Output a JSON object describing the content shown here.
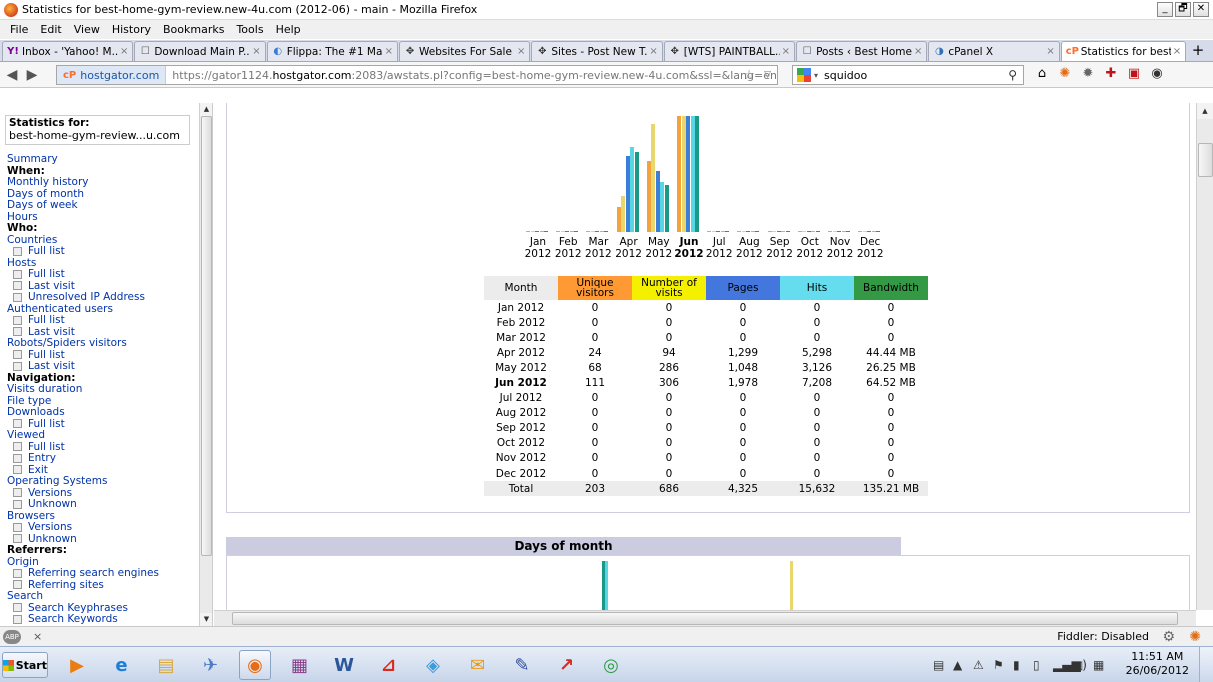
{
  "window": {
    "title": "Statistics for best-home-gym-review.new-4u.com (2012-06) - main - Mozilla Firefox",
    "min": "_",
    "max": "🗗",
    "close": "✕"
  },
  "menubar": [
    "File",
    "Edit",
    "View",
    "History",
    "Bookmarks",
    "Tools",
    "Help"
  ],
  "tabs": [
    {
      "label": "Inbox - 'Yahoo! M...",
      "icon": "Y!",
      "color": "#7b0099"
    },
    {
      "label": "Download Main P...",
      "icon": "☐",
      "color": "#555555"
    },
    {
      "label": "Flippa: The #1 Ma...",
      "icon": "◐",
      "color": "#3a7bd5"
    },
    {
      "label": "Websites For Sale ...",
      "icon": "✥",
      "color": "#333333"
    },
    {
      "label": "Sites - Post New T...",
      "icon": "✥",
      "color": "#333333"
    },
    {
      "label": "[WTS] PAINTBALL...",
      "icon": "✥",
      "color": "#333333"
    },
    {
      "label": "Posts ‹ Best Home...",
      "icon": "☐",
      "color": "#555555"
    },
    {
      "label": "cPanel X",
      "icon": "◑",
      "color": "#2f6fb7"
    },
    {
      "label": "Statistics for best-...",
      "icon": "cP",
      "color": "#ff6c2c"
    }
  ],
  "tab_close": "×",
  "tab_new": "+",
  "nav": {
    "back": "◀",
    "forward": "▶",
    "site_id": "hostgator.com",
    "site_prefix": "cP",
    "url_pre": "https://gator1124.",
    "url_domain": "hostgator.com",
    "url_post": ":2083/awstats.pl?config=best-home-gym-review.new-4u.com&ssl=&lang=en",
    "star": "☆",
    "url_drop": "▽",
    "search_value": "squidoo",
    "search_caret": "▾",
    "search_icon": "⚲",
    "toolbar_icons": [
      "⌂",
      "✺",
      "✹",
      "✚",
      "▣",
      "◉"
    ]
  },
  "sidebar": {
    "stats_label": "Statistics for:",
    "stats_value": "best-home-gym-review...u.com",
    "items": [
      {
        "t": "Summary",
        "k": "link"
      },
      {
        "t": "When:",
        "k": "head"
      },
      {
        "t": "Monthly history",
        "k": "link"
      },
      {
        "t": "Days of month",
        "k": "link"
      },
      {
        "t": "Days of week",
        "k": "link"
      },
      {
        "t": "Hours",
        "k": "link"
      },
      {
        "t": "Who:",
        "k": "head"
      },
      {
        "t": "Countries",
        "k": "link"
      },
      {
        "t": "Full list",
        "k": "sub"
      },
      {
        "t": "Hosts",
        "k": "link"
      },
      {
        "t": "Full list",
        "k": "sub"
      },
      {
        "t": "Last visit",
        "k": "sub"
      },
      {
        "t": "Unresolved IP Address",
        "k": "sub"
      },
      {
        "t": "Authenticated users",
        "k": "link"
      },
      {
        "t": "Full list",
        "k": "sub"
      },
      {
        "t": "Last visit",
        "k": "sub"
      },
      {
        "t": "Robots/Spiders visitors",
        "k": "link"
      },
      {
        "t": "Full list",
        "k": "sub"
      },
      {
        "t": "Last visit",
        "k": "sub"
      },
      {
        "t": "Navigation:",
        "k": "head"
      },
      {
        "t": "Visits duration",
        "k": "link"
      },
      {
        "t": "File type",
        "k": "link"
      },
      {
        "t": "Downloads",
        "k": "link"
      },
      {
        "t": "Full list",
        "k": "sub"
      },
      {
        "t": "Viewed",
        "k": "link"
      },
      {
        "t": "Full list",
        "k": "sub"
      },
      {
        "t": "Entry",
        "k": "sub"
      },
      {
        "t": "Exit",
        "k": "sub"
      },
      {
        "t": "Operating Systems",
        "k": "link"
      },
      {
        "t": "Versions",
        "k": "sub"
      },
      {
        "t": "Unknown",
        "k": "sub"
      },
      {
        "t": "Browsers",
        "k": "link"
      },
      {
        "t": "Versions",
        "k": "sub"
      },
      {
        "t": "Unknown",
        "k": "sub"
      },
      {
        "t": "Referrers:",
        "k": "head"
      },
      {
        "t": "Origin",
        "k": "link"
      },
      {
        "t": "Referring search engines",
        "k": "sub"
      },
      {
        "t": "Referring sites",
        "k": "sub"
      },
      {
        "t": "Search",
        "k": "link"
      },
      {
        "t": "Search Keyphrases",
        "k": "sub"
      },
      {
        "t": "Search Keywords",
        "k": "sub"
      }
    ],
    "scroll_up": "▲",
    "scroll_down": "▼"
  },
  "monthly": {
    "headers": [
      "Month",
      "Unique visitors",
      "Number of visits",
      "Pages",
      "Hits",
      "Bandwidth"
    ],
    "header_colors": [
      "#ececec",
      "#ff9933",
      "#f4f000",
      "#4477dd",
      "#66ddee",
      "#339944"
    ],
    "current_month": "Jun 2012",
    "rows": [
      [
        "Jan 2012",
        "0",
        "0",
        "0",
        "0",
        "0"
      ],
      [
        "Feb 2012",
        "0",
        "0",
        "0",
        "0",
        "0"
      ],
      [
        "Mar 2012",
        "0",
        "0",
        "0",
        "0",
        "0"
      ],
      [
        "Apr 2012",
        "24",
        "94",
        "1,299",
        "5,298",
        "44.44 MB"
      ],
      [
        "May 2012",
        "68",
        "286",
        "1,048",
        "3,126",
        "26.25 MB"
      ],
      [
        "Jun 2012",
        "111",
        "306",
        "1,978",
        "7,208",
        "64.52 MB"
      ],
      [
        "Jul 2012",
        "0",
        "0",
        "0",
        "0",
        "0"
      ],
      [
        "Aug 2012",
        "0",
        "0",
        "0",
        "0",
        "0"
      ],
      [
        "Sep 2012",
        "0",
        "0",
        "0",
        "0",
        "0"
      ],
      [
        "Oct 2012",
        "0",
        "0",
        "0",
        "0",
        "0"
      ],
      [
        "Nov 2012",
        "0",
        "0",
        "0",
        "0",
        "0"
      ],
      [
        "Dec 2012",
        "0",
        "0",
        "0",
        "0",
        "0"
      ]
    ],
    "total": [
      "Total",
      "203",
      "686",
      "4,325",
      "15,632",
      "135.21 MB"
    ],
    "chart_months": [
      {
        "m": "Jan",
        "y": "2012"
      },
      {
        "m": "Feb",
        "y": "2012"
      },
      {
        "m": "Mar",
        "y": "2012"
      },
      {
        "m": "Apr",
        "y": "2012"
      },
      {
        "m": "May",
        "y": "2012"
      },
      {
        "m": "Jun",
        "y": "2012"
      },
      {
        "m": "Jul",
        "y": "2012"
      },
      {
        "m": "Aug",
        "y": "2012"
      },
      {
        "m": "Sep",
        "y": "2012"
      },
      {
        "m": "Oct",
        "y": "2012"
      },
      {
        "m": "Nov",
        "y": "2012"
      },
      {
        "m": "Dec",
        "y": "2012"
      }
    ],
    "bar_colors": [
      "#f4a23a",
      "#e9d66c",
      "#3c7fd8",
      "#57d6e5",
      "#1a9988"
    ]
  },
  "days_of_month": {
    "title": "Days of month"
  },
  "status": {
    "abp": "ABP",
    "close": "×",
    "fiddler": "Fiddler: Disabled",
    "gear": "⚙",
    "fox": "✺"
  },
  "taskbar": {
    "start": "Start",
    "apps": [
      "▶",
      "e",
      "▤",
      "✈",
      "◉",
      "▦",
      "W",
      "⊿",
      "◈",
      "✉",
      "✎",
      "↗",
      "◎"
    ],
    "tray": [
      "▤",
      "▲",
      "⚠",
      "⚑",
      "▮",
      "▯",
      "▂▄▆",
      "◁)",
      "▦"
    ],
    "time": "11:51 AM",
    "date": "26/06/2012"
  }
}
